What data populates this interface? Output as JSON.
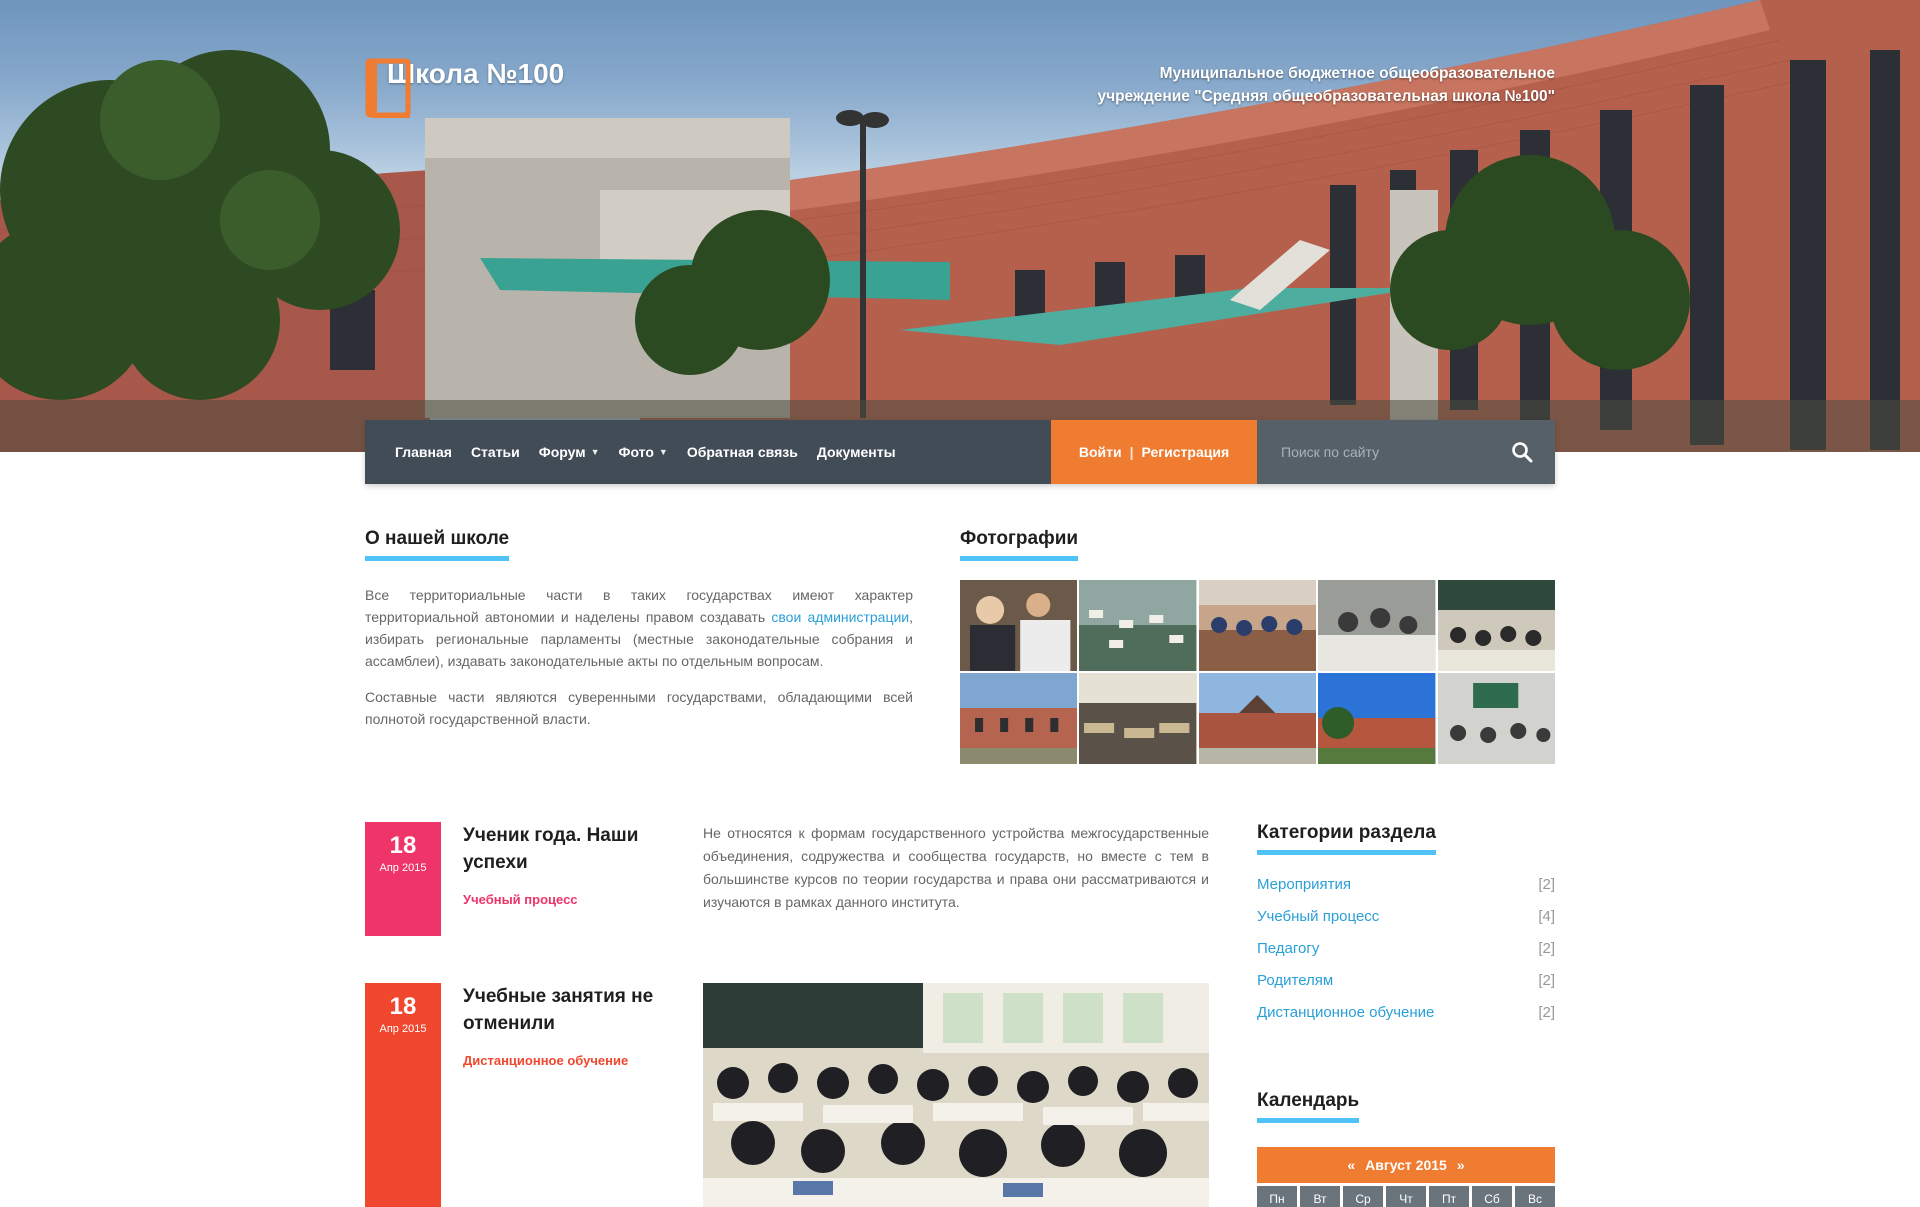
{
  "header": {
    "school_name": "Школа №100",
    "org_line1": "Муниципальное бюджетное общеобразовательное",
    "org_line2": "учреждение \"Средняя общеобразовательная школа №100\"",
    "icon": "book-icon"
  },
  "nav": {
    "items": [
      {
        "label": "Главная",
        "has_dropdown": false
      },
      {
        "label": "Статьи",
        "has_dropdown": false
      },
      {
        "label": "Форум",
        "has_dropdown": true
      },
      {
        "label": "Фото",
        "has_dropdown": true
      },
      {
        "label": "Обратная связь",
        "has_dropdown": false
      },
      {
        "label": "Документы",
        "has_dropdown": false
      }
    ],
    "login": "Войти",
    "separator": "|",
    "register": "Регистрация",
    "search_placeholder": "Поиск по сайту",
    "search_icon": "search-icon"
  },
  "about": {
    "title": "О нашей школе",
    "p1_a": "Все территориальные части в таких государствах имеют характер территориальной автономии и наделены правом создавать ",
    "p1_link": "свои администрации",
    "p1_b": ", избирать региональные парламенты (местные законодательные собрания и ассамблеи), издавать законодательные акты по отдельным вопросам.",
    "p2": "Составные части являются суверенными государствами, обладающими всей полнотой государственной власти."
  },
  "photos": {
    "title": "Фотографии"
  },
  "news": [
    {
      "day": "18",
      "month": "Апр 2015",
      "title": "Ученик года. Наши успехи",
      "category": "Учебный процесс",
      "color": "#ee3468",
      "excerpt": "Не относятся к формам государственного устройства межгосударственные объединения, содружества и сообщества государств, но вместе с тем в большинстве курсов по теории государства и права они рассматриваются и изучаются в рамках данного института."
    },
    {
      "day": "18",
      "month": "Апр 2015",
      "title": "Учебные занятия не отменили",
      "category": "Дистанционное обучение",
      "color": "#f1472f"
    }
  ],
  "sidebar": {
    "categories_title": "Категории раздела",
    "categories": [
      {
        "label": "Мероприятия",
        "count": "[2]"
      },
      {
        "label": "Учебный процесс",
        "count": "[4]"
      },
      {
        "label": "Педагогу",
        "count": "[2]"
      },
      {
        "label": "Родителям",
        "count": "[2]"
      },
      {
        "label": "Дистанционное обучение",
        "count": "[2]"
      }
    ],
    "calendar_title": "Календарь",
    "calendar_month": "Август 2015",
    "calendar_prev": "«",
    "calendar_next": "»",
    "weekdays": [
      "Пн",
      "Вт",
      "Ср",
      "Чт",
      "Пт",
      "Сб",
      "Вс"
    ]
  },
  "colors": {
    "accent_orange": "#ef7c31",
    "nav_dark": "#424c57",
    "link_blue": "#2a9fd8",
    "heading_underline": "#4fc3f7"
  }
}
